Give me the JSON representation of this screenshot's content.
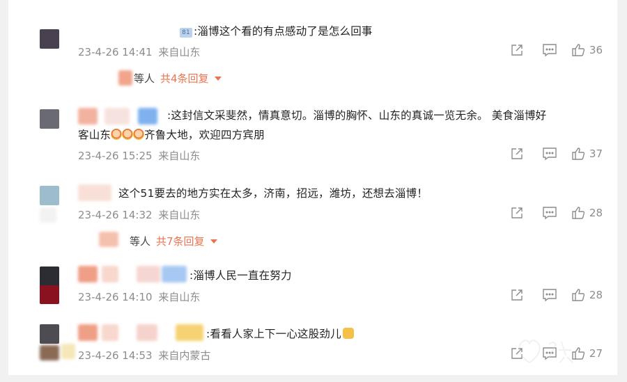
{
  "comments": [
    {
      "user_badge": "81",
      "text": ":淄博这个看的有点感动了是怎么回事",
      "time": "23-4-26 14:41",
      "source": "来自山东",
      "likes": "36",
      "replies": {
        "who": "等人",
        "count": "共4条回复"
      }
    },
    {
      "text_line1": ":这封信文采斐然，情真意切。淄博的胸怀、山东的真诚一览无余。 美食淄博好",
      "text_line2_a": "客山东",
      "text_line2_b": "齐鲁大地，欢迎四方宾朋",
      "time": "23-4-26 15:25",
      "source": "来自山东",
      "likes": "37"
    },
    {
      "text": "这个51要去的地方实在太多，济南，招远，潍坊，还想去淄博！",
      "time": "23-4-26 14:32",
      "source": "来自山东",
      "likes": "28",
      "replies": {
        "who": "等人",
        "count": "共7条回复"
      }
    },
    {
      "text": ":淄博人民一直在努力",
      "time": "23-4-26 14:10",
      "source": "来自山东",
      "likes": "28"
    },
    {
      "text": ":看看人家上下一心这股劲儿",
      "time": "23-4-26 14:53",
      "source": "来自内蒙古",
      "likes": "27"
    }
  ],
  "icons": {
    "share": "share-icon",
    "comment": "comment-icon",
    "like": "thumbs-up-icon",
    "dropdown": "caret-down-icon"
  },
  "colors": {
    "accent": "#eb7350",
    "meta": "#8c8c8c",
    "text": "#222222"
  }
}
